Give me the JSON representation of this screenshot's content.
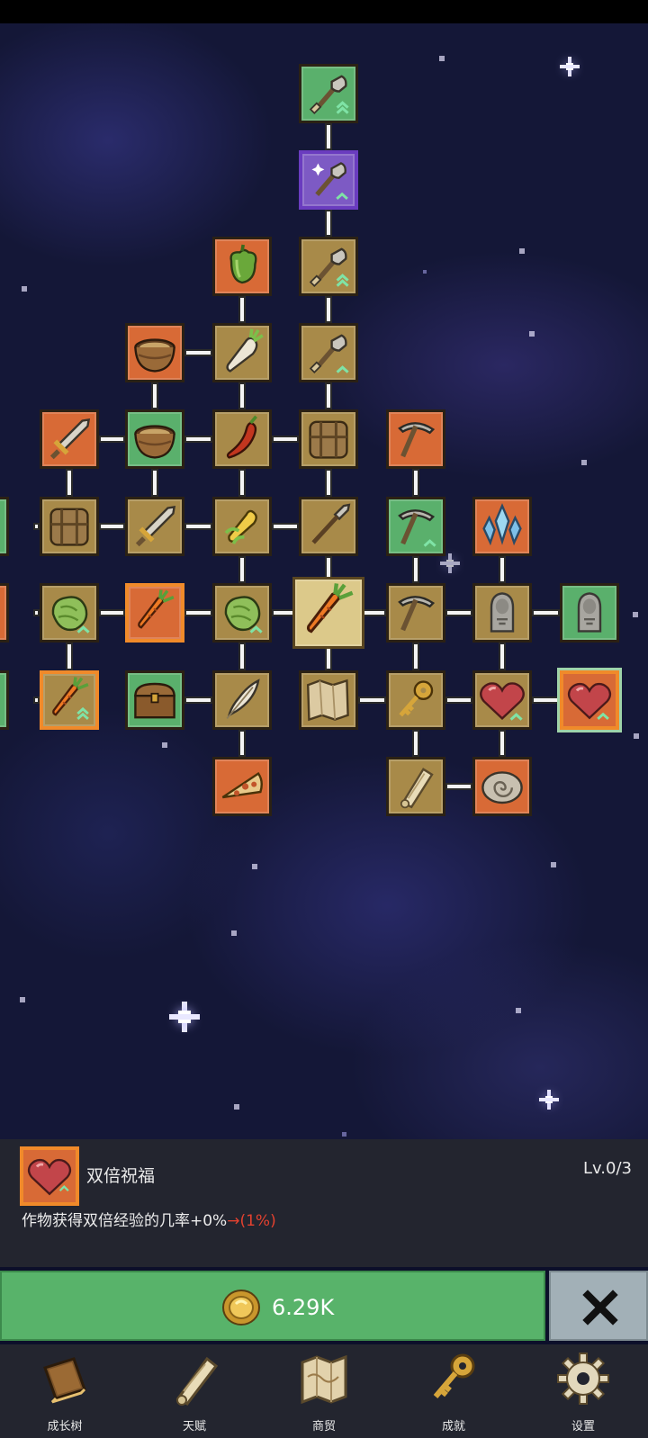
{
  "colors": {
    "node_tan": "#a88a49",
    "node_orange": "#d86a36",
    "node_green": "#5ab06c",
    "node_purple": "#7d5ac4",
    "upgrade_green": "#58b36a",
    "close_gray": "#a2b0b7",
    "next_value_red": "#e3412f"
  },
  "skill_tree": {
    "nodes": [
      {
        "id": "shovel-top",
        "icon": "shovel-icon",
        "color": "green",
        "upgrades": 2
      },
      {
        "id": "magic-shovel",
        "icon": "magic-shovel-icon",
        "color": "purple",
        "upgrades": 1
      },
      {
        "id": "shovel-3",
        "icon": "shovel-icon",
        "color": "tan",
        "upgrades": 2
      },
      {
        "id": "shovel-4",
        "icon": "shovel-icon",
        "color": "tan",
        "upgrades": 1
      },
      {
        "id": "pepper",
        "icon": "pepper-icon",
        "color": "orange"
      },
      {
        "id": "radish",
        "icon": "radish-icon",
        "color": "tan"
      },
      {
        "id": "bowl-orange",
        "icon": "bowl-icon",
        "color": "orange"
      },
      {
        "id": "sword-orange",
        "icon": "sword-icon",
        "color": "orange"
      },
      {
        "id": "bowl-green",
        "icon": "bowl-icon",
        "color": "green"
      },
      {
        "id": "chili",
        "icon": "chili-icon",
        "color": "tan"
      },
      {
        "id": "backpack",
        "icon": "backpack-icon",
        "color": "tan"
      },
      {
        "id": "pickaxe-orange",
        "icon": "pickaxe-icon",
        "color": "orange"
      },
      {
        "id": "backpack-2",
        "icon": "backpack-icon",
        "color": "tan"
      },
      {
        "id": "sword-2",
        "icon": "sword-icon",
        "color": "tan"
      },
      {
        "id": "corn",
        "icon": "corn-icon",
        "color": "tan"
      },
      {
        "id": "spear",
        "icon": "spear-icon",
        "color": "tan"
      },
      {
        "id": "pickaxe-green",
        "icon": "pickaxe-icon",
        "color": "green",
        "upgrades": 1
      },
      {
        "id": "crystal",
        "icon": "crystal-icon",
        "color": "orange"
      },
      {
        "id": "cabbage-1",
        "icon": "cabbage-icon",
        "color": "tan",
        "upgrades": 1
      },
      {
        "id": "carrot-orange",
        "icon": "carrot-icon",
        "color": "orange"
      },
      {
        "id": "cabbage-2",
        "icon": "cabbage-icon",
        "color": "tan",
        "upgrades": 1
      },
      {
        "id": "carrot-center",
        "icon": "carrot-icon",
        "color": "tan",
        "selected": true
      },
      {
        "id": "pickaxe-tan",
        "icon": "pickaxe-icon",
        "color": "tan"
      },
      {
        "id": "statue-tan",
        "icon": "statue-icon",
        "color": "tan"
      },
      {
        "id": "statue-green",
        "icon": "statue-icon",
        "color": "green"
      },
      {
        "id": "carrot-tan",
        "icon": "carrot-icon",
        "color": "tan",
        "upgrades": 2
      },
      {
        "id": "chest",
        "icon": "chest-icon",
        "color": "green"
      },
      {
        "id": "feather",
        "icon": "feather-icon",
        "color": "tan"
      },
      {
        "id": "map",
        "icon": "map-icon",
        "color": "tan"
      },
      {
        "id": "key",
        "icon": "key-icon",
        "color": "tan"
      },
      {
        "id": "heart-tan",
        "icon": "heart-icon",
        "color": "tan",
        "upgrades": 1
      },
      {
        "id": "heart-orange",
        "icon": "heart-icon",
        "color": "orange",
        "upgrades": 1
      },
      {
        "id": "pizza",
        "icon": "pizza-icon",
        "color": "orange"
      },
      {
        "id": "scroll",
        "icon": "scroll-icon",
        "color": "tan"
      },
      {
        "id": "fossil",
        "icon": "fossil-icon",
        "color": "orange"
      },
      {
        "id": "partial-r4",
        "icon": "",
        "color": "green"
      },
      {
        "id": "partial-r5",
        "icon": "",
        "color": "orange"
      },
      {
        "id": "partial-r6",
        "icon": "",
        "color": "green"
      }
    ]
  },
  "info": {
    "icon": "heart-icon",
    "name": "双倍祝福",
    "level": "Lv.0/3",
    "desc": "作物获得双倍经验的几率+0%",
    "next": "→(1%)"
  },
  "actions": {
    "upgrade_cost": "6.29K",
    "coin_icon": "gold-coin-icon",
    "close_icon": "close-icon"
  },
  "nav": [
    {
      "label": "成长树",
      "icon": "book-icon"
    },
    {
      "label": "天赋",
      "icon": "scroll-icon"
    },
    {
      "label": "商贸",
      "icon": "map-icon"
    },
    {
      "label": "成就",
      "icon": "key-icon"
    },
    {
      "label": "设置",
      "icon": "gear-icon"
    }
  ]
}
